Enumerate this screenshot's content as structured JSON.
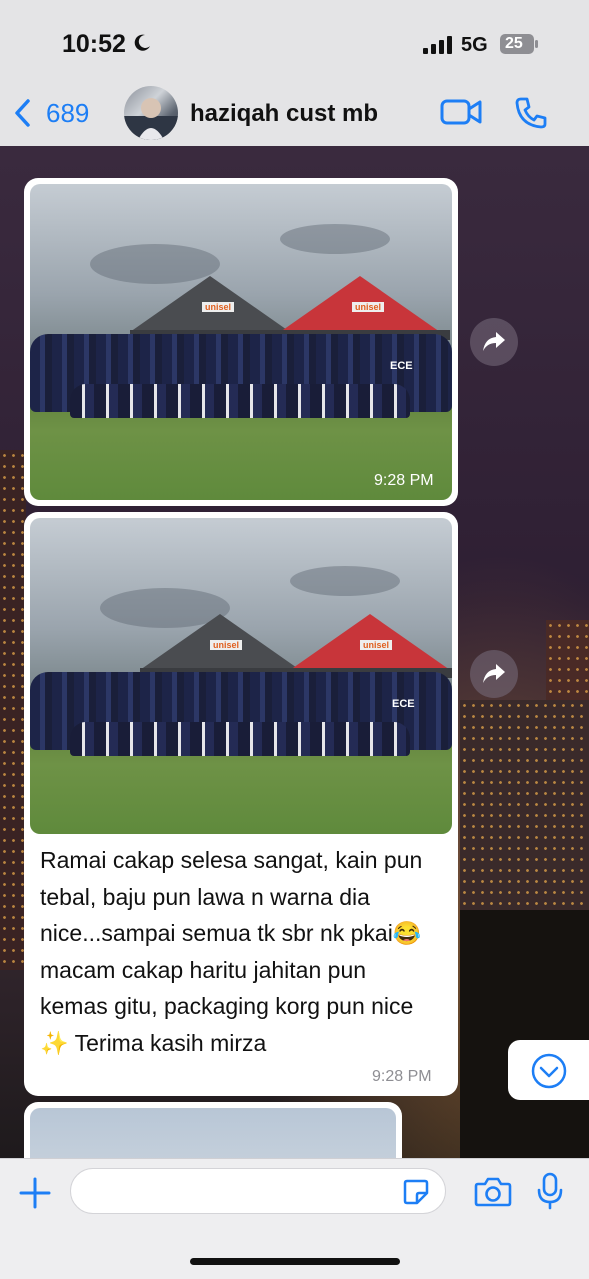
{
  "status": {
    "time": "10:52",
    "network": "5G",
    "battery": "25"
  },
  "nav": {
    "back_count": "689",
    "contact_name": "haziqah cust mb"
  },
  "messages": [
    {
      "type": "image",
      "time": "9:28 PM",
      "tent_brand": "unisel",
      "shirt_text": "ECE"
    },
    {
      "type": "image_caption",
      "time": "9:28 PM",
      "text": "Ramai cakap selesa sangat, kain pun tebal, baju pun lawa n warna dia nice...sampai semua tk sbr nk pkai😂 macam cakap haritu jahitan pun kemas gitu, packaging korg pun nice ✨ Terima kasih mirza"
    }
  ],
  "composer": {
    "placeholder": ""
  },
  "colors": {
    "accent": "#1d7ef5",
    "bubble": "#ffffff",
    "bar": "#e4e4e6"
  }
}
